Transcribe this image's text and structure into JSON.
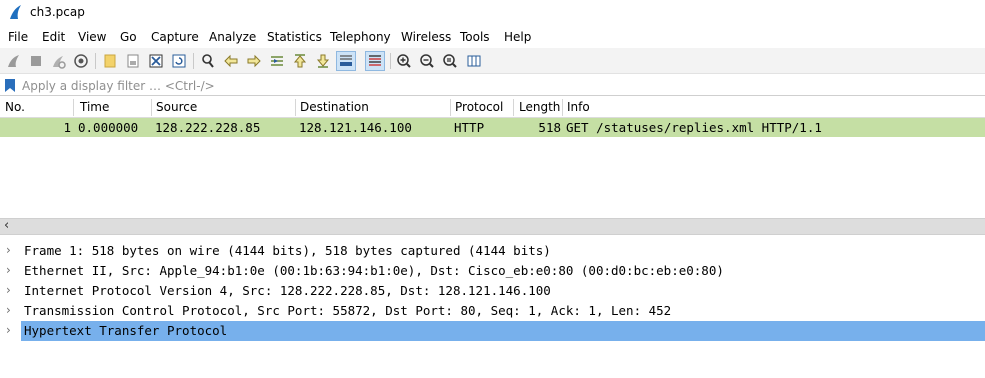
{
  "window": {
    "title": "ch3.pcap"
  },
  "menu": [
    "File",
    "Edit",
    "View",
    "Go",
    "Capture",
    "Analyze",
    "Statistics",
    "Telephony",
    "Wireless",
    "Tools",
    "Help"
  ],
  "toolbar": {
    "icons": [
      "shark-fin-start-icon",
      "stop-icon",
      "restart-icon",
      "options-gear-icon",
      "open-folder-icon",
      "save-icon",
      "close-file-icon",
      "reload-icon",
      "find-icon",
      "go-back-icon",
      "go-forward-icon",
      "go-to-packet-icon",
      "first-packet-icon",
      "last-packet-icon",
      "autoscroll-icon",
      "colorize-icon",
      "zoom-in-icon",
      "zoom-out-icon",
      "zoom-normal-icon",
      "resize-columns-icon"
    ]
  },
  "filter": {
    "placeholder": "Apply a display filter … <Ctrl-/>"
  },
  "packet_list": {
    "columns": [
      "No.",
      "Time",
      "Source",
      "Destination",
      "Protocol",
      "Length",
      "Info"
    ],
    "rows": [
      {
        "no": "1",
        "time": "0.000000",
        "source": "128.222.228.85",
        "destination": "128.121.146.100",
        "protocol": "HTTP",
        "length": "518",
        "info": "GET /statuses/replies.xml HTTP/1.1"
      }
    ],
    "row_color": "#c5dfa4"
  },
  "details": {
    "rows": [
      "Frame 1: 518 bytes on wire (4144 bits), 518 bytes captured (4144 bits)",
      "Ethernet II, Src: Apple_94:b1:0e (00:1b:63:94:b1:0e), Dst: Cisco_eb:e0:80 (00:d0:bc:eb:e0:80)",
      "Internet Protocol Version 4, Src: 128.222.228.85, Dst: 128.121.146.100",
      "Transmission Control Protocol, Src Port: 55872, Dst Port: 80, Seq: 1, Ack: 1, Len: 452",
      "Hypertext Transfer Protocol"
    ],
    "selected_color": "#77b0ec"
  },
  "colors": {
    "toolbar_bg": "#f3f3f3",
    "scrollbar_bg": "#dddddd",
    "accent": "#2a6ebb"
  }
}
